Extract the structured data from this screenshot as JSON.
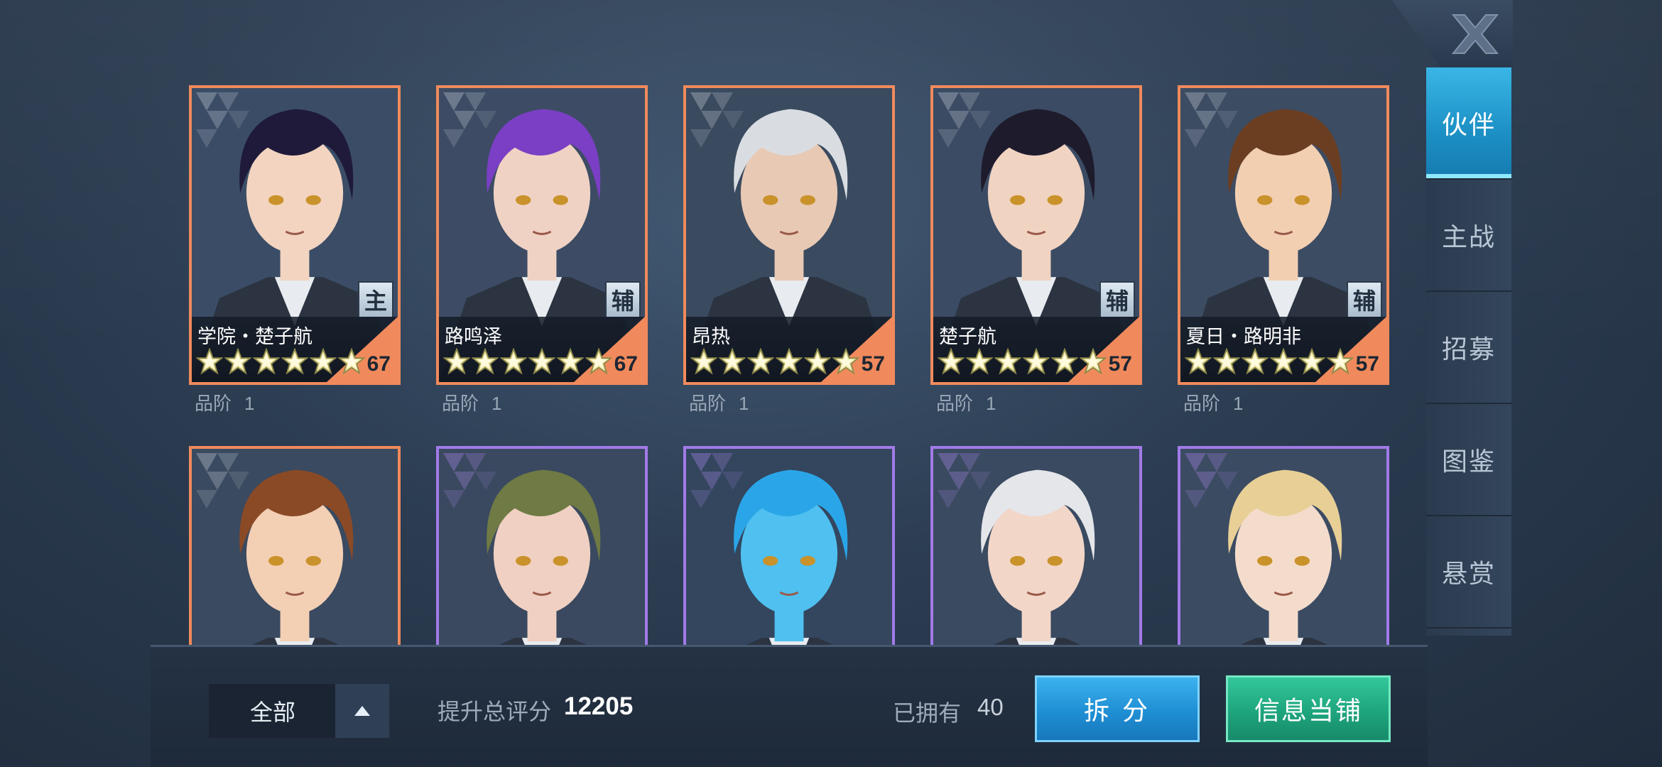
{
  "close": {
    "icon": "close-icon"
  },
  "tabs": [
    {
      "label": "伙伴",
      "active": true
    },
    {
      "label": "主战",
      "active": false
    },
    {
      "label": "招募",
      "active": false
    },
    {
      "label": "图鉴",
      "active": false
    },
    {
      "label": "悬赏",
      "active": false
    }
  ],
  "partners": [
    {
      "name": "学院・楚子航",
      "role": "主",
      "level": "67",
      "stars": 6,
      "grade_label": "品阶",
      "grade": "1",
      "frame": "orange",
      "hair": "#1f1a3a",
      "skin": "#f2d4c0",
      "bg": "#3b4d66"
    },
    {
      "name": "路鸣泽",
      "role": "辅",
      "level": "67",
      "stars": 6,
      "grade_label": "品阶",
      "grade": "1",
      "frame": "orange",
      "hair": "#7a3fc4",
      "skin": "#f0d2c4",
      "bg": "#3d4c64"
    },
    {
      "name": "昂热",
      "role": "",
      "level": "57",
      "stars": 6,
      "grade_label": "品阶",
      "grade": "1",
      "frame": "orange",
      "hair": "#d9dde2",
      "skin": "#e8c9b4",
      "bg": "#3a4a5f"
    },
    {
      "name": "楚子航",
      "role": "辅",
      "level": "57",
      "stars": 6,
      "grade_label": "品阶",
      "grade": "1",
      "frame": "orange",
      "hair": "#1e1b2c",
      "skin": "#f1d3c2",
      "bg": "#3b4b63"
    },
    {
      "name": "夏日・路明非",
      "role": "辅",
      "level": "57",
      "stars": 6,
      "grade_label": "品阶",
      "grade": "1",
      "frame": "orange",
      "hair": "#6b3e22",
      "skin": "#f3cfb2",
      "bg": "#3c4c63"
    },
    {
      "name": "",
      "role": "",
      "level": "",
      "stars": 0,
      "grade_label": "",
      "grade": "",
      "frame": "orange",
      "hair": "#8a4a26",
      "skin": "#f3cfb4",
      "bg": "#3a4a60"
    },
    {
      "name": "",
      "role": "",
      "level": "",
      "stars": 0,
      "grade_label": "",
      "grade": "",
      "frame": "purple",
      "hair": "#6f7a45",
      "skin": "#f0d0c2",
      "bg": "#3a495f"
    },
    {
      "name": "",
      "role": "",
      "level": "",
      "stars": 0,
      "grade_label": "",
      "grade": "",
      "frame": "purple",
      "hair": "#2aa6e8",
      "skin": "#4fc0f0",
      "bg": "#33465e"
    },
    {
      "name": "",
      "role": "",
      "level": "",
      "stars": 0,
      "grade_label": "",
      "grade": "",
      "frame": "purple",
      "hair": "#e4e6ea",
      "skin": "#f2d6c8",
      "bg": "#3a4a60"
    },
    {
      "name": "",
      "role": "",
      "level": "",
      "stars": 0,
      "grade_label": "",
      "grade": "",
      "frame": "purple",
      "hair": "#e8cf96",
      "skin": "#f4dccc",
      "bg": "#3b4b62"
    }
  ],
  "bottom": {
    "filter_label": "全部",
    "score_label": "提升总评分",
    "score_value": "12205",
    "owned_label": "已拥有",
    "owned_value": "40",
    "split_label": "拆 分",
    "shop_label": "信息当铺"
  },
  "colors": {
    "accent_blue": "#1f8fd4",
    "accent_green": "#1ea57e",
    "frame_orange": "#f08a5c",
    "frame_purple": "#a27ae8"
  }
}
